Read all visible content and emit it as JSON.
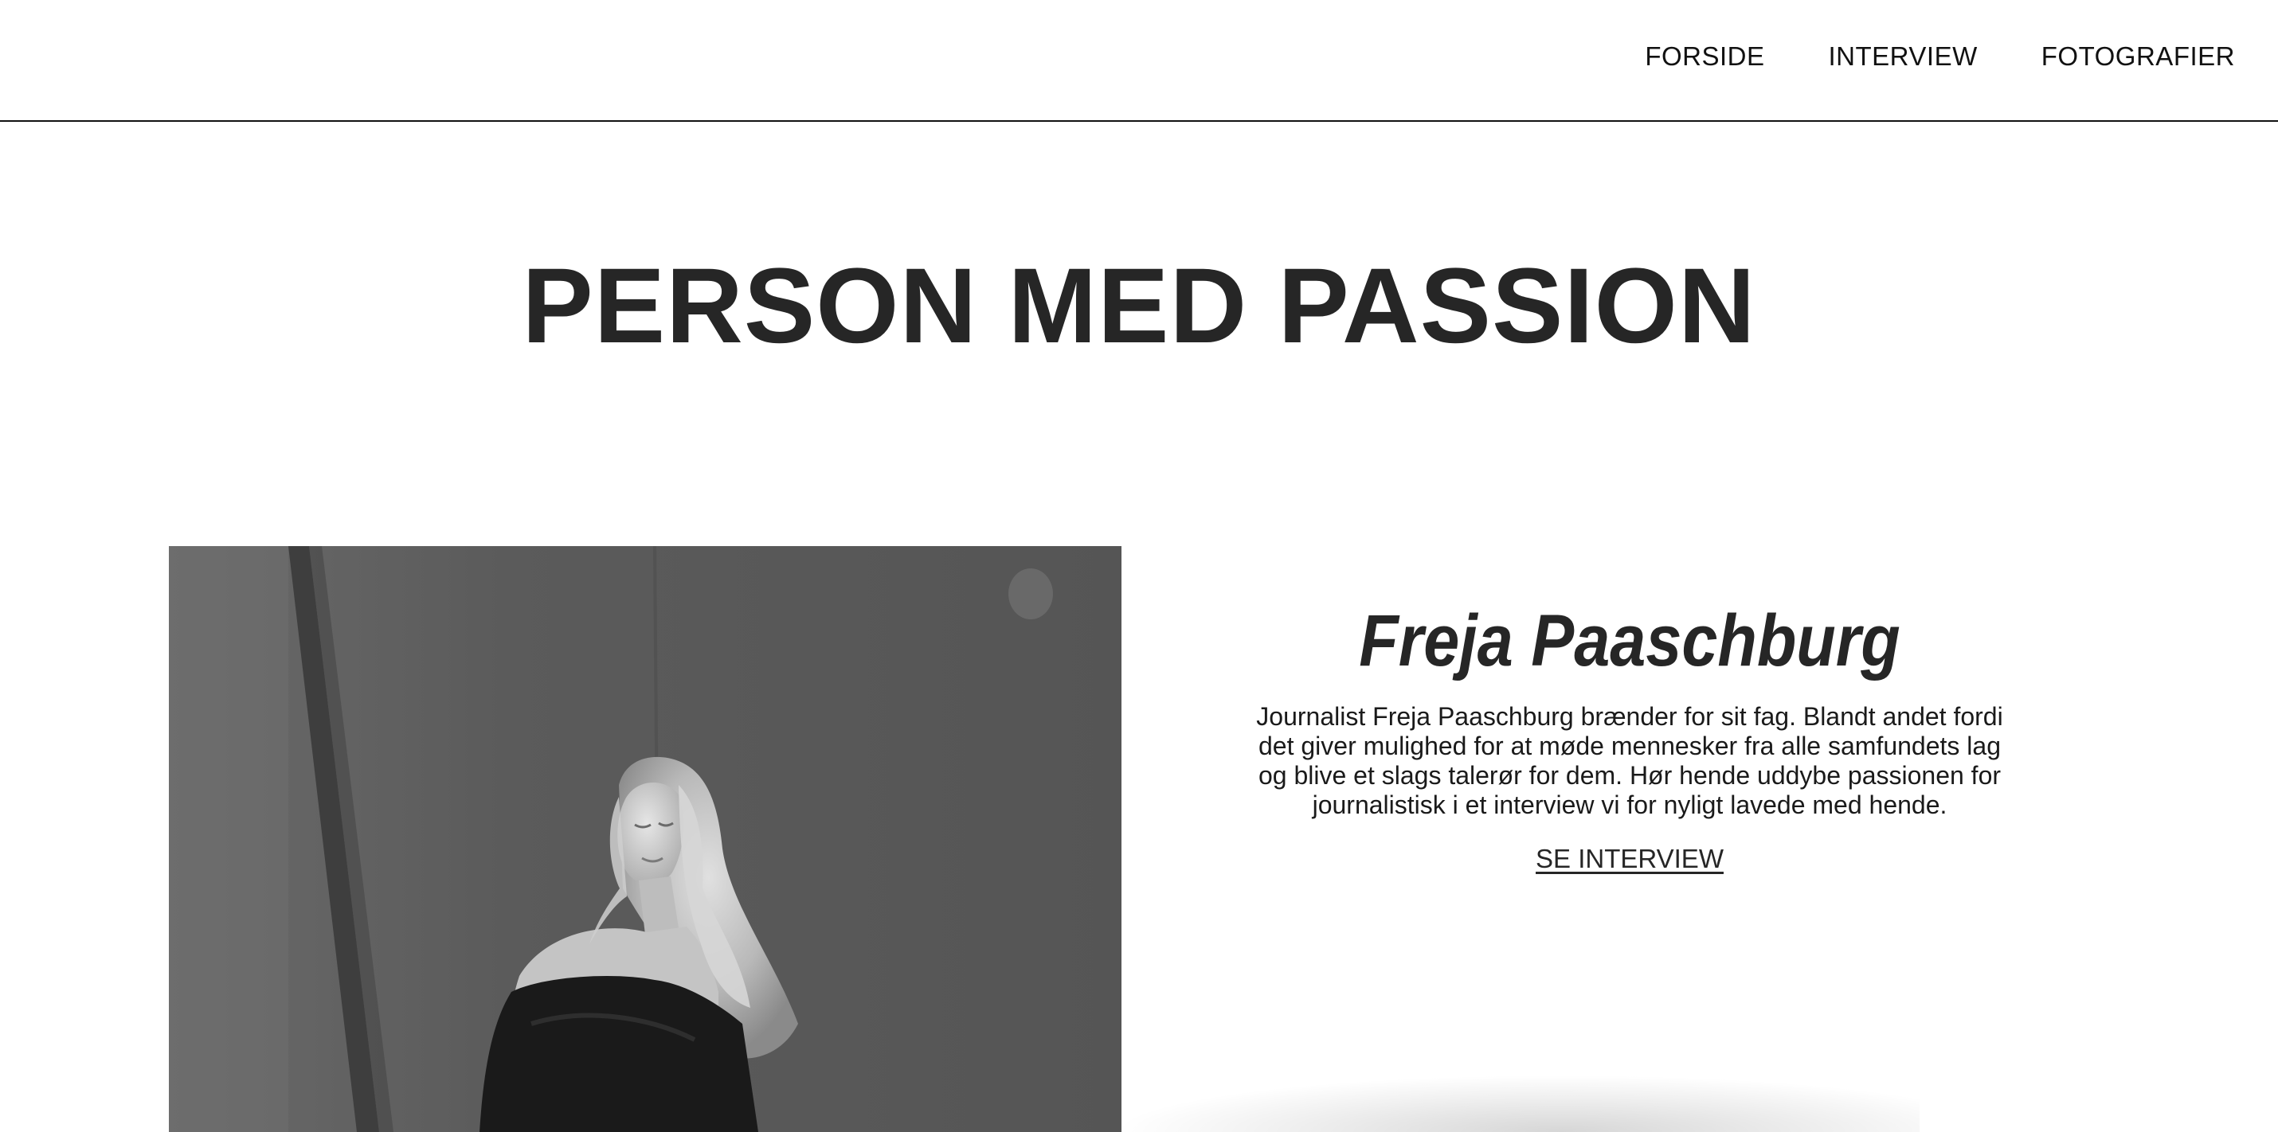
{
  "nav": {
    "items": [
      {
        "label": "FORSIDE"
      },
      {
        "label": "INTERVIEW"
      },
      {
        "label": "FOTOGRAFIER"
      }
    ]
  },
  "hero": {
    "title": "PERSON MED PASSION"
  },
  "profile": {
    "name": "Freja Paaschburg",
    "description": "Journalist Freja Paaschburg brænder for sit fag. Blandt andet fordi det giver mulighed for at møde mennesker fra alle samfundets lag og blive et slags talerør for dem. Hør hende uddybe passionen for journalistisk i et interview vi for nyligt lavede med hende.",
    "link_label": "SE INTERVIEW"
  },
  "colors": {
    "text": "#111111",
    "heading": "#262626",
    "background": "#ffffff"
  }
}
